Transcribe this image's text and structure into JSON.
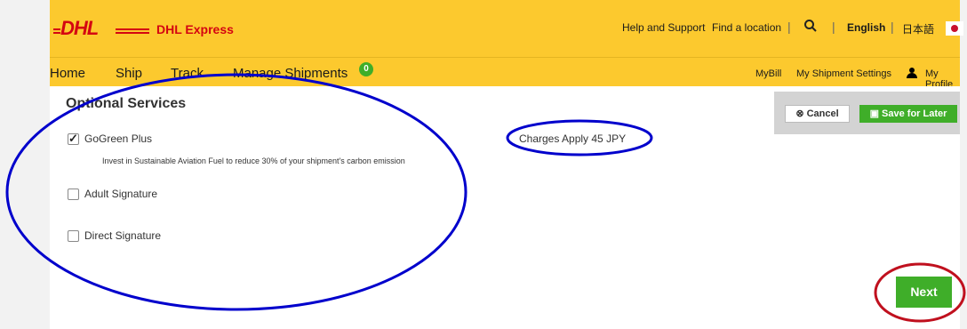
{
  "header": {
    "brand": "DHL Express",
    "help_link": "Help and Support",
    "location_link": "Find a location",
    "lang_english": "English",
    "lang_japanese": "日本語",
    "search_icon": "search-icon",
    "flag_icon": "japan-flag-icon"
  },
  "nav": {
    "home": "Home",
    "ship": "Ship",
    "track": "Track",
    "manage": "Manage Shipments",
    "manage_badge": "0",
    "mybill": "MyBill",
    "settings": "My Shipment Settings",
    "profile": "My Profile"
  },
  "main": {
    "title": "Optional Services",
    "options": [
      {
        "label": "GoGreen Plus",
        "checked": true
      },
      {
        "label": "Adult Signature",
        "checked": false
      },
      {
        "label": "Direct Signature",
        "checked": false
      }
    ],
    "gogreen_desc": "Invest in Sustainable Aviation Fuel to reduce 30% of your shipment's carbon emission",
    "charge_text": "Charges Apply 45 JPY"
  },
  "actions": {
    "cancel": "Cancel",
    "save": "Save for Later",
    "next": "Next"
  },
  "colors": {
    "dhl_yellow": "#fcc92e",
    "dhl_red": "#d40511",
    "green": "#3fae29",
    "annotation_blue": "#0000cc",
    "annotation_red": "#c0101e"
  }
}
